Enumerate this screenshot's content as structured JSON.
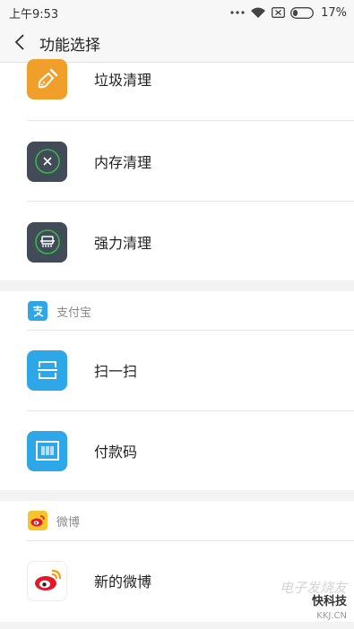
{
  "status_bar": {
    "time": "上午9:53",
    "battery_percent": "17%"
  },
  "header": {
    "title": "功能选择"
  },
  "cleaner_section": {
    "items": [
      {
        "label": "垃圾清理",
        "icon": "broom-icon",
        "color": "#f0a02a"
      },
      {
        "label": "内存清理",
        "icon": "memory-clean-icon",
        "color": "#424b58"
      },
      {
        "label": "强力清理",
        "icon": "deep-clean-icon",
        "color": "#424b58"
      }
    ]
  },
  "alipay_section": {
    "group_label": "支付宝",
    "group_icon": "alipay-icon",
    "color": "#2ea7e8",
    "items": [
      {
        "label": "扫一扫",
        "icon": "scan-icon"
      },
      {
        "label": "付款码",
        "icon": "barcode-icon"
      }
    ]
  },
  "weibo_section": {
    "group_label": "微博",
    "group_icon": "weibo-icon",
    "items": [
      {
        "label": "新的微博",
        "icon": "weibo-icon"
      }
    ]
  },
  "watermark": {
    "line1": "电子发烧友",
    "line2": "快科技",
    "line3": "KKJ.CN"
  }
}
